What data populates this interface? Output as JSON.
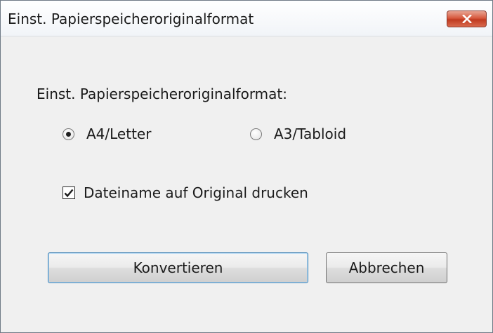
{
  "window": {
    "title": "Einst. Papierspeicheroriginalformat"
  },
  "dialog": {
    "group_label": "Einst. Papierspeicheroriginalformat:",
    "radios": [
      {
        "label": "A4/Letter",
        "checked": true
      },
      {
        "label": "A3/Tabloid",
        "checked": false
      }
    ],
    "checkbox": {
      "label": "Dateiname auf Original drucken",
      "checked": true
    },
    "buttons": {
      "convert_label": "Konvertieren",
      "cancel_label": "Abbrechen"
    }
  },
  "colors": {
    "close_button": "#d7593e",
    "background": "#f0f0f0",
    "default_button_border": "#3c7fb1"
  },
  "icons": {
    "close": "close-icon",
    "check": "checkmark-icon"
  }
}
